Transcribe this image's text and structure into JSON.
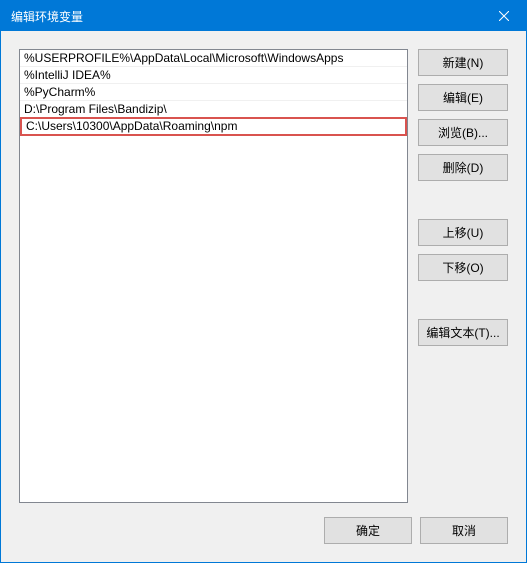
{
  "dialog": {
    "title": "编辑环境变量"
  },
  "list": {
    "items": [
      {
        "value": "%USERPROFILE%\\AppData\\Local\\Microsoft\\WindowsApps",
        "highlighted": false
      },
      {
        "value": "%IntelliJ IDEA%",
        "highlighted": false
      },
      {
        "value": "%PyCharm%",
        "highlighted": false
      },
      {
        "value": "D:\\Program Files\\Bandizip\\",
        "highlighted": false
      },
      {
        "value": "C:\\Users\\10300\\AppData\\Roaming\\npm",
        "highlighted": true
      }
    ]
  },
  "buttons": {
    "new": "新建(N)",
    "edit": "编辑(E)",
    "browse": "浏览(B)...",
    "delete": "删除(D)",
    "move_up": "上移(U)",
    "move_down": "下移(O)",
    "edit_text": "编辑文本(T)...",
    "ok": "确定",
    "cancel": "取消"
  }
}
